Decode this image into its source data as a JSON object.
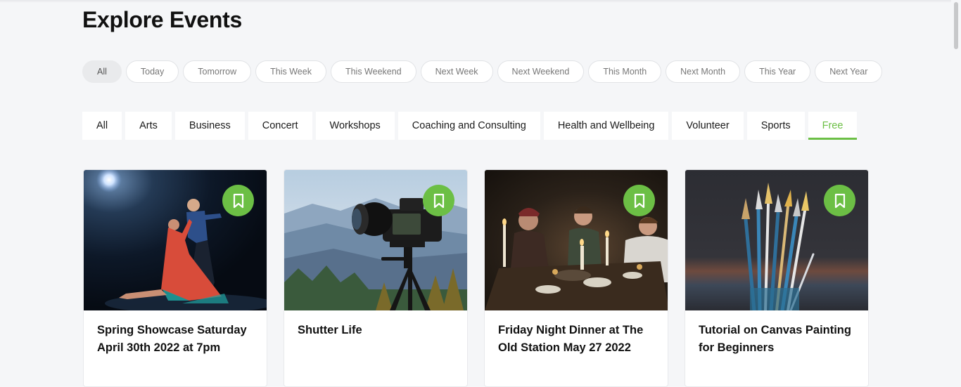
{
  "page": {
    "title": "Explore Events"
  },
  "date_filters": [
    {
      "label": "All",
      "active": true
    },
    {
      "label": "Today"
    },
    {
      "label": "Tomorrow"
    },
    {
      "label": "This Week"
    },
    {
      "label": "This Weekend"
    },
    {
      "label": "Next Week"
    },
    {
      "label": "Next Weekend"
    },
    {
      "label": "This Month"
    },
    {
      "label": "Next Month"
    },
    {
      "label": "This Year"
    },
    {
      "label": "Next Year"
    }
  ],
  "categories": [
    {
      "label": "All"
    },
    {
      "label": "Arts"
    },
    {
      "label": "Business"
    },
    {
      "label": "Concert"
    },
    {
      "label": "Workshops"
    },
    {
      "label": "Coaching and Consulting"
    },
    {
      "label": "Health and Wellbeing"
    },
    {
      "label": "Volunteer"
    },
    {
      "label": "Sports"
    },
    {
      "label": "Free",
      "active": true
    }
  ],
  "events": [
    {
      "title": "Spring Showcase Saturday April 30th 2022 at 7pm",
      "image": "tango-dancers"
    },
    {
      "title": "Shutter Life",
      "image": "camera-on-tripod"
    },
    {
      "title": "Friday Night Dinner at The Old Station May 27 2022",
      "image": "candlelit-dinner"
    },
    {
      "title": "Tutorial on Canvas Painting for Beginners",
      "image": "paint-brushes"
    }
  ],
  "colors": {
    "accent": "#6cbf45",
    "background": "#f5f6f8"
  },
  "icons": {
    "bookmark": "bookmark-icon"
  }
}
